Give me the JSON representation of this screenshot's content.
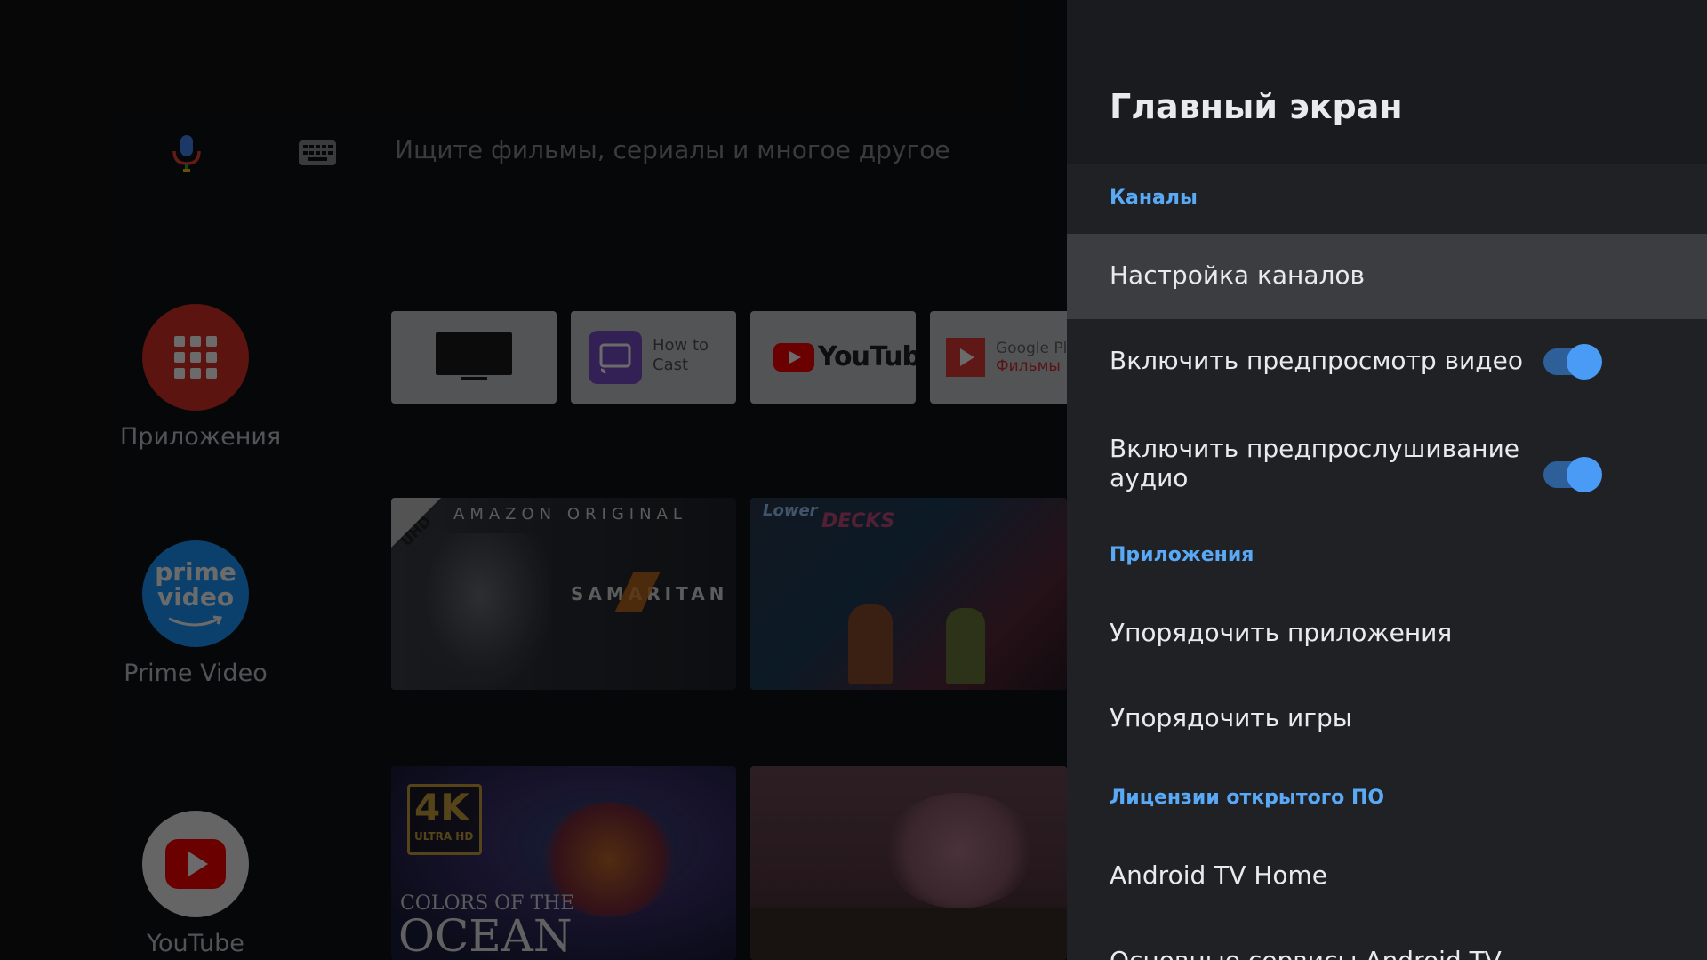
{
  "search": {
    "placeholder": "Ищите фильмы, сериалы и многое другое"
  },
  "sidebar": {
    "apps": [
      {
        "label": "Приложения",
        "icon": "apps-grid-icon",
        "color": "#d93025"
      },
      {
        "label": "Prime Video",
        "icon": "prime-video-logo",
        "color": "#1a98ff",
        "logo_text": [
          "prime",
          "video"
        ]
      },
      {
        "label": "YouTube",
        "icon": "youtube-icon",
        "color": "#ff0000"
      }
    ]
  },
  "favorites": {
    "apps": [
      {
        "name": "tv-app",
        "icon": "tv-icon"
      },
      {
        "name": "how-to-cast",
        "label_line1": "How to",
        "label_line2": "Cast",
        "icon": "cast-icon"
      },
      {
        "name": "youtube",
        "label": "YouTube",
        "icon": "youtube-logo"
      },
      {
        "name": "google-play-movies",
        "label_line1": "Google Pl",
        "label_line2": "Фильмы",
        "icon": "play-movies-icon"
      }
    ]
  },
  "content": {
    "prime_tile": {
      "badge": "UHD",
      "brand": "AMAZON ORIGINAL",
      "title": "SAMARITAN"
    },
    "lower_decks_tile": {
      "title_line1": "Lower",
      "title_line2": "DECKS"
    },
    "ocean_tile": {
      "badge_big": "4K",
      "badge_small": "ULTRA HD",
      "title_small": "COLORS OF THE",
      "title_big": "OCEAN"
    }
  },
  "settings": {
    "title": "Главный экран",
    "sections": {
      "channels": "Каналы",
      "apps": "Приложения",
      "licenses": "Лицензии открытого ПО"
    },
    "items": {
      "channel_setup": "Настройка каналов",
      "video_preview": "Включить предпросмотр видео",
      "audio_preview": "Включить предпрослушивание аудио",
      "sort_apps": "Упорядочить приложения",
      "sort_games": "Упорядочить игры",
      "android_tv_home": "Android TV Home",
      "core_services": "Основные сервисы Android TV"
    },
    "toggles": {
      "video_preview": true,
      "audio_preview": true
    },
    "accent_color": "#5aa9f6"
  }
}
